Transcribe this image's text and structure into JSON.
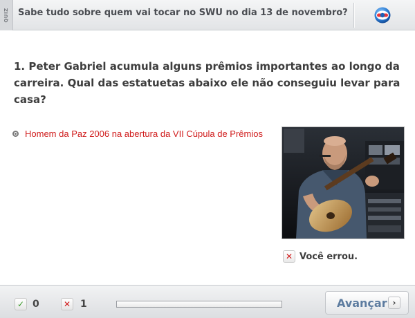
{
  "header": {
    "tag": "QUIZ",
    "title": "Sabe tudo sobre quem vai tocar no SWU no dia 13 de novembro?",
    "logo_icon": "globo-logo-icon"
  },
  "question": {
    "text": "1. Peter Gabriel acumula alguns prêmios importantes ao longo da carreira. Qual das estatuetas abaixo ele não conseguiu levar para casa?"
  },
  "options": [
    {
      "label": "Homem da Paz 2006 na abertura da VII Cúpula de Prêmios",
      "color": "#d01c1c",
      "icon": "radio-icon"
    }
  ],
  "photo": {
    "icon": "performer-photo"
  },
  "feedback": {
    "icon": "x-icon",
    "icon_glyph": "✕",
    "text": "Você errou."
  },
  "footer": {
    "correct": {
      "icon": "check-icon",
      "glyph": "✓",
      "count": "0"
    },
    "wrong": {
      "icon": "x-icon",
      "glyph": "✕",
      "count": "1"
    },
    "progress": 0,
    "next": {
      "label": "Avançar",
      "arrow": "›",
      "icon": "chevron-right-icon"
    }
  },
  "colors": {
    "accent_blue": "#5d7ca0",
    "error_red": "#d01c1c",
    "success_green": "#3a9a2a"
  }
}
